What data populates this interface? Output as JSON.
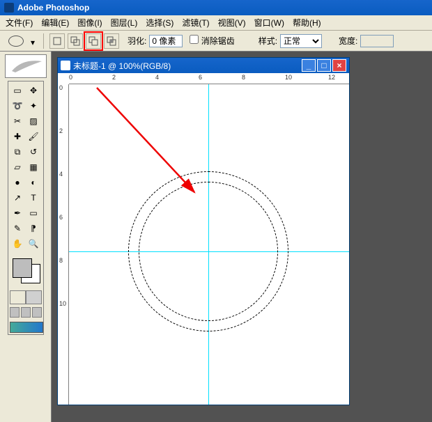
{
  "app": {
    "title": "Adobe Photoshop"
  },
  "menu": {
    "file": "文件(F)",
    "edit": "编辑(E)",
    "image": "图像(I)",
    "layer": "图层(L)",
    "select": "选择(S)",
    "filter": "滤镜(T)",
    "view": "视图(V)",
    "window": "窗口(W)",
    "help": "帮助(H)"
  },
  "options": {
    "feather_label": "羽化:",
    "feather_value": "0 像素",
    "antialias_label": "消除锯齿",
    "style_label": "样式:",
    "style_value": "正常",
    "width_label": "宽度:"
  },
  "doc": {
    "title": "未标题-1 @ 100%(RGB/8)"
  },
  "ruler_h": [
    "0",
    "2",
    "4",
    "6",
    "8",
    "10",
    "12"
  ],
  "ruler_v": [
    "0",
    "2",
    "4",
    "6",
    "8",
    "10"
  ],
  "tools": [
    [
      "marquee",
      "move"
    ],
    [
      "lasso",
      "wand"
    ],
    [
      "crop",
      "slice"
    ],
    [
      "heal",
      "brush"
    ],
    [
      "stamp",
      "history"
    ],
    [
      "eraser",
      "gradient"
    ],
    [
      "blur",
      "dodge"
    ],
    [
      "path",
      "type"
    ],
    [
      "pen",
      "shape"
    ],
    [
      "notes",
      "eyedrop"
    ],
    [
      "hand",
      "zoom"
    ]
  ],
  "icons": {
    "marquee": "▭",
    "move": "✥",
    "lasso": "➰",
    "wand": "✦",
    "crop": "✂",
    "slice": "▨",
    "heal": "✚",
    "brush": "🖌",
    "stamp": "⧉",
    "history": "↺",
    "eraser": "▱",
    "gradient": "▦",
    "blur": "●",
    "dodge": "◐",
    "path": "↗",
    "type": "T",
    "pen": "✒",
    "shape": "▭",
    "notes": "✎",
    "eyedrop": "⁋",
    "hand": "✋",
    "zoom": "🔍"
  }
}
